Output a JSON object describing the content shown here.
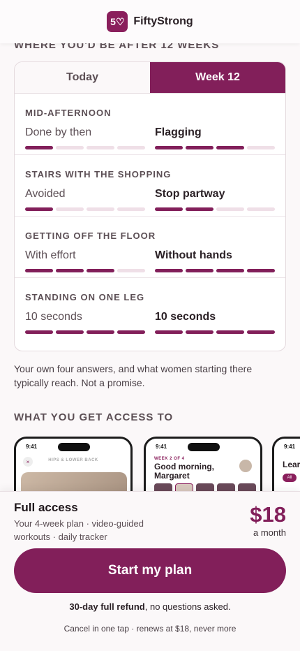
{
  "brand": {
    "logo_mark": "5♡",
    "name": "FiftyStrong",
    "accent": "#821f5a"
  },
  "section1_heading": "WHERE YOU'D BE AFTER 12 WEEKS",
  "tabs": {
    "today": "Today",
    "week": "Week 12"
  },
  "metrics": [
    {
      "title": "MID-AFTERNOON",
      "today": "Done by then",
      "today_level": 1,
      "week": "Flagging",
      "week_level": 3
    },
    {
      "title": "STAIRS WITH THE SHOPPING",
      "today": "Avoided",
      "today_level": 1,
      "week": "Stop partway",
      "week_level": 2
    },
    {
      "title": "GETTING OFF THE FLOOR",
      "today": "With effort",
      "today_level": 3,
      "week": "Without hands",
      "week_level": 4
    },
    {
      "title": "STANDING ON ONE LEG",
      "today": "10 seconds",
      "today_level": 4,
      "week": "10 seconds",
      "week_level": 4
    }
  ],
  "disclaimer": "Your own four answers, and what women starting there typically reach. Not a promise.",
  "section2_heading": "WHAT YOU GET ACCESS TO",
  "phones": {
    "p1": {
      "time": "9:41",
      "title": "HIPS & LOWER BACK",
      "close": "×"
    },
    "p2": {
      "time": "9:41",
      "week": "WEEK 2 OF 4",
      "greeting": "Good morning, Margaret"
    },
    "p3": {
      "time": "9:41",
      "heading": "Lear",
      "chip": "All"
    }
  },
  "plan": {
    "title": "Full access",
    "description": "Your 4-week plan · video-guided workouts · daily tracker",
    "price": "$18",
    "period": "a month"
  },
  "cta_label": "Start my plan",
  "refund_bold": "30-day full refund",
  "refund_rest": ", no questions asked.",
  "cancel_note": "Cancel in one tap · renews at $18, never more"
}
